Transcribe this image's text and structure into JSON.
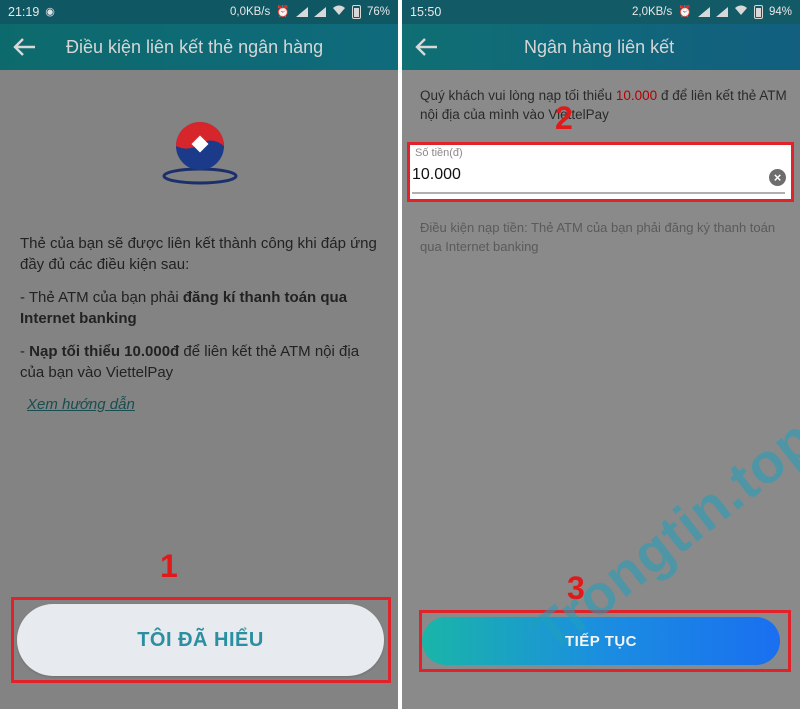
{
  "colors": {
    "marker_red": "#e01a1a",
    "brand_teal": "#0f6a74",
    "button_gradient_start": "#1ab5a8",
    "button_gradient_end": "#1a6ff0",
    "amount_red": "#b30000"
  },
  "left_screen": {
    "status_bar": {
      "time": "21:19",
      "speed": "0,0KB/s",
      "battery": "76%",
      "icons": [
        "notification-icon",
        "alarm-icon",
        "signal-icon",
        "signal-icon",
        "wifi-icon",
        "battery-icon"
      ]
    },
    "header": {
      "back_icon": "arrow-left-icon",
      "title": "Điều kiện liên kết thẻ ngân hàng"
    },
    "logo": "bank-logo",
    "intro": "Thẻ của bạn sẽ được liên kết thành công khi đáp ứng đầy đủ các điều kiện sau:",
    "condition1": {
      "prefix": "- Thẻ ATM của bạn phải ",
      "bold": "đăng kí thanh toán qua Internet banking"
    },
    "condition2": {
      "prefix": "- ",
      "bold": "Nạp tối thiểu 10.000đ",
      "suffix": " để liên kết thẻ ATM nội địa của bạn vào ViettelPay"
    },
    "guide_link": "Xem hướng dẫn",
    "button": "TÔI ĐÃ HIỂU",
    "step_marker": "1"
  },
  "right_screen": {
    "status_bar": {
      "time": "15:50",
      "speed": "2,0KB/s",
      "battery": "94%",
      "icons": [
        "alarm-icon",
        "signal-icon",
        "signal-icon",
        "wifi-icon",
        "battery-icon"
      ]
    },
    "header": {
      "back_icon": "arrow-left-icon",
      "title": "Ngân hàng liên kết"
    },
    "info": {
      "prefix": "Quý khách vui lòng nạp tối thiểu ",
      "amount": "10.000",
      "suffix": " đ để liên kết thẻ ATM nội địa của mình vào ViettelPay"
    },
    "amount_field": {
      "label": "Số tiền(đ)",
      "value": "10.000",
      "clear_icon": "clear-icon"
    },
    "condition_note": "Điều kiện nạp tiền: Thẻ ATM của bạn phải đăng ký thanh toán qua Internet banking",
    "button": "TIẾP TỤC",
    "step_marker_field": "2",
    "step_marker_button": "3"
  },
  "watermark": "Trongtin.top"
}
